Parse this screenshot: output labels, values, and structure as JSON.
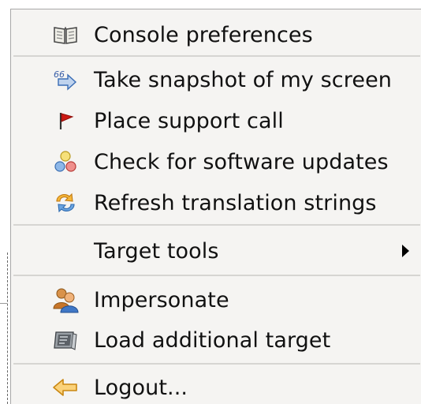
{
  "menu": {
    "items": [
      {
        "label": "Console preferences",
        "icon": "book-icon"
      },
      {
        "label": "Take snapshot of my screen",
        "icon": "snapshot-icon"
      },
      {
        "label": "Place support call",
        "icon": "flag-icon"
      },
      {
        "label": "Check for software updates",
        "icon": "updates-icon"
      },
      {
        "label": "Refresh translation strings",
        "icon": "refresh-icon"
      },
      {
        "label": "Target tools",
        "icon": ""
      },
      {
        "label": "Impersonate",
        "icon": "user-group-icon"
      },
      {
        "label": "Load additional target",
        "icon": "target-icon"
      },
      {
        "label": "Logout...",
        "icon": "logout-arrow-icon"
      }
    ]
  },
  "colors": {
    "menu_background": "#f5f4f2",
    "separator": "#d6d5d2",
    "flag_red": "#cc1a14",
    "logout_orange": "#f2a320"
  }
}
